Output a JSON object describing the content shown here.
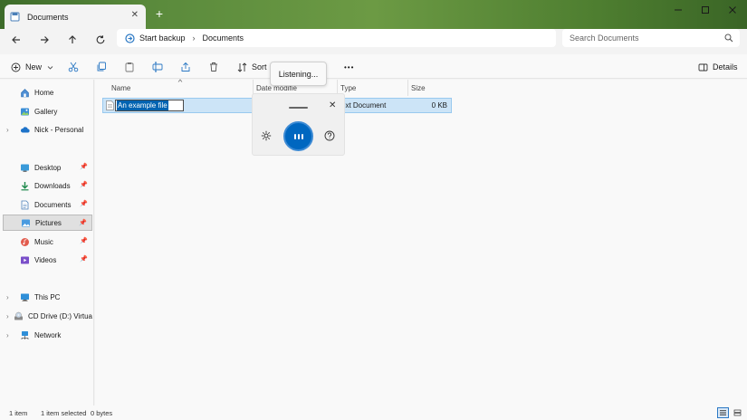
{
  "window": {
    "tab_label": "Documents",
    "tab_close": "✕",
    "new_tab": "+"
  },
  "address": {
    "backup": "Start backup",
    "separator": "›",
    "location": "Documents"
  },
  "search": {
    "placeholder": "Search Documents"
  },
  "toolbar": {
    "new_label": "New",
    "sort_label": "Sort",
    "more_label": "•••",
    "details_label": "Details"
  },
  "sidebar": {
    "items": [
      {
        "label": "Home"
      },
      {
        "label": "Gallery"
      },
      {
        "label": "Nick - Personal"
      },
      {
        "label": "Desktop"
      },
      {
        "label": "Downloads"
      },
      {
        "label": "Documents"
      },
      {
        "label": "Pictures"
      },
      {
        "label": "Music"
      },
      {
        "label": "Videos"
      },
      {
        "label": "This PC"
      },
      {
        "label": "CD Drive (D:) Virtua"
      },
      {
        "label": "Network"
      }
    ]
  },
  "columns": {
    "name": "Name",
    "date": "Date modifie",
    "type": "Type",
    "size": "Size"
  },
  "file": {
    "name": "An example file",
    "type": "ext Document",
    "size": "0 KB"
  },
  "voice": {
    "status": "Listening...",
    "close": "✕"
  },
  "status": {
    "count": "1 item",
    "selected": "1 item selected",
    "bytes": "0 bytes"
  },
  "colors": {
    "accent": "#0067c0",
    "selection": "#cce4f7",
    "highlight": "#0063b1"
  }
}
